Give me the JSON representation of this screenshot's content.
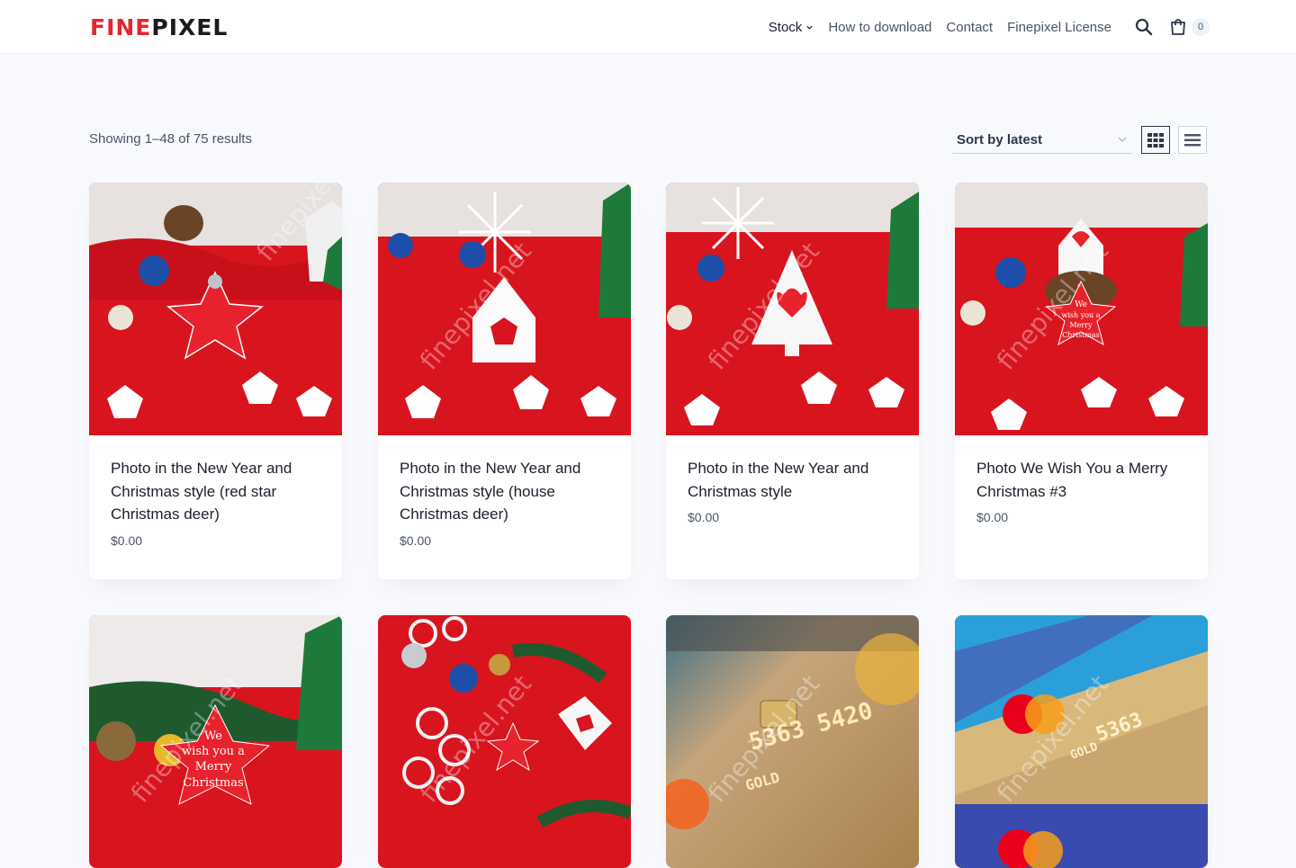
{
  "header": {
    "logo_part1": "FINE",
    "logo_part2": "PIXEL",
    "nav": [
      {
        "label": "Stock",
        "has_dropdown": true
      },
      {
        "label": "How to download"
      },
      {
        "label": "Contact"
      },
      {
        "label": "Finepixel License"
      }
    ],
    "cart_count": "0",
    "icons": [
      "search-icon",
      "cart-icon"
    ]
  },
  "toolbar": {
    "results_text": "Showing 1–48 of 75 results",
    "sort_label": "Sort by latest",
    "icons": [
      "grid-view-icon",
      "list-view-icon"
    ]
  },
  "products": [
    {
      "title": "Photo in the New Year and Christmas style (red star Christmas deer)",
      "price": "$0.00"
    },
    {
      "title": "Photo in the New Year and Christmas style (house Christmas deer)",
      "price": "$0.00"
    },
    {
      "title": "Photo in the New Year and Christmas style",
      "price": "$0.00"
    },
    {
      "title": "Photo We Wish You a Merry Christmas #3",
      "price": "$0.00"
    },
    {
      "title": "",
      "price": ""
    },
    {
      "title": "",
      "price": ""
    },
    {
      "title": "",
      "price": ""
    },
    {
      "title": "",
      "price": ""
    }
  ],
  "theme": {
    "brand_red": "#e3262e",
    "card_bg": "#ffffff",
    "page_bg": "#f7f9fc"
  }
}
